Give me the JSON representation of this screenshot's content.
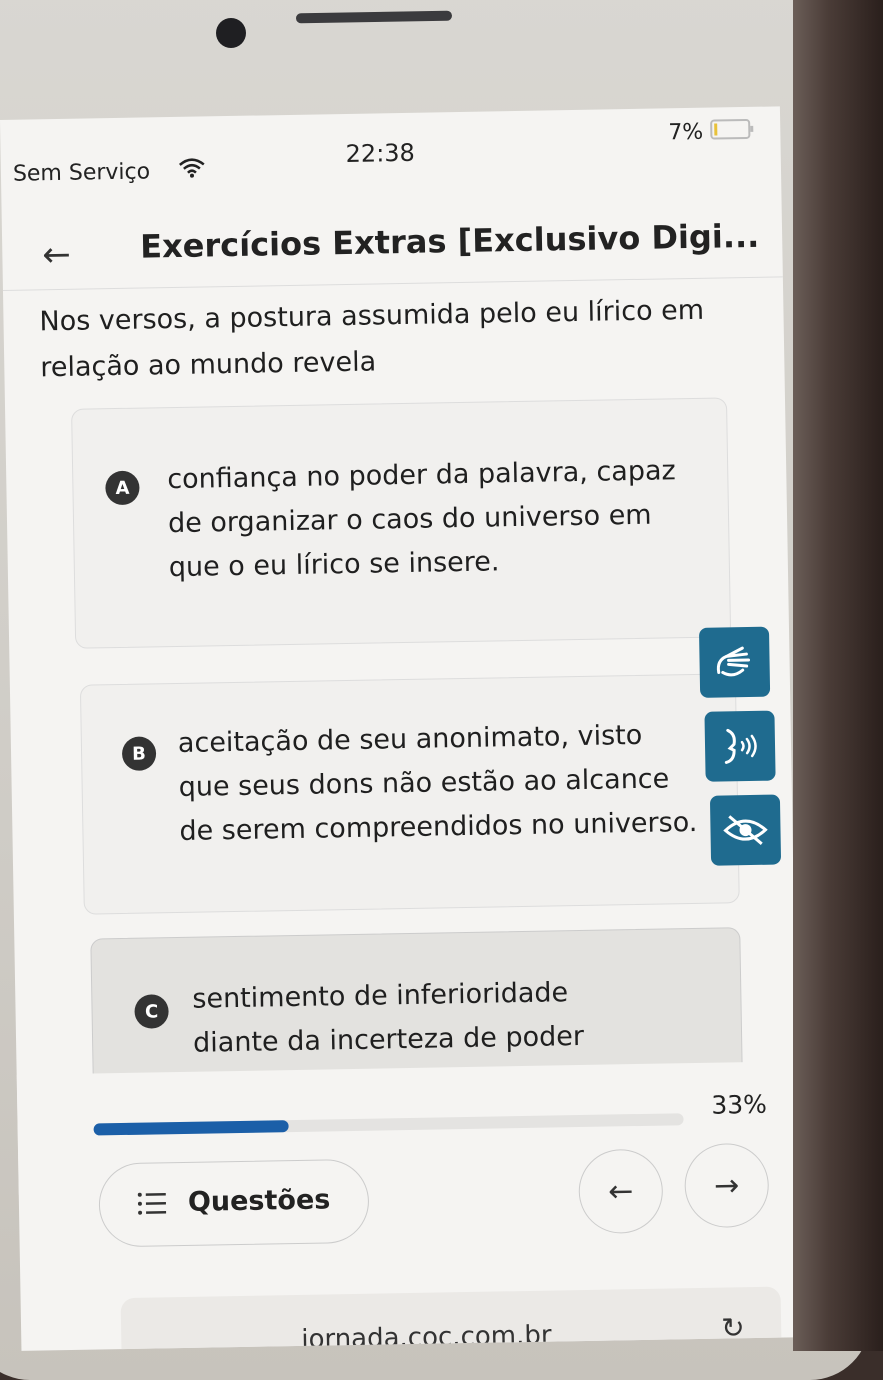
{
  "status": {
    "carrier": "Sem Serviço",
    "time": "22:38",
    "battery": "7%"
  },
  "header": {
    "title": "Exercícios Extras [Exclusivo Digi..."
  },
  "question": {
    "text": "Nos versos, a postura assumida pelo eu lírico em relação ao mundo revela"
  },
  "options": [
    {
      "letter": "A",
      "text": "confiança no poder da palavra, capaz de organizar o caos do universo em que o eu lírico se insere."
    },
    {
      "letter": "B",
      "text": "aceitação de seu anonimato, visto que seus dons não estão ao alcance de serem compreendidos no universo."
    },
    {
      "letter": "C",
      "text": "sentimento de inferioridade diante da incerteza de poder nomear os acontecimentos do"
    }
  ],
  "accessibility_tools": [
    {
      "icon": "sign-language-icon"
    },
    {
      "icon": "text-to-speech-icon"
    },
    {
      "icon": "hide-eye-icon"
    }
  ],
  "progress": {
    "percent_label": "33%",
    "value": 0.33
  },
  "footer": {
    "questions_label": "Questões"
  },
  "browser": {
    "url": "jornada.coc.com.br"
  },
  "colors": {
    "accent": "#1b5fa8",
    "a11y": "#1f6b8f"
  }
}
